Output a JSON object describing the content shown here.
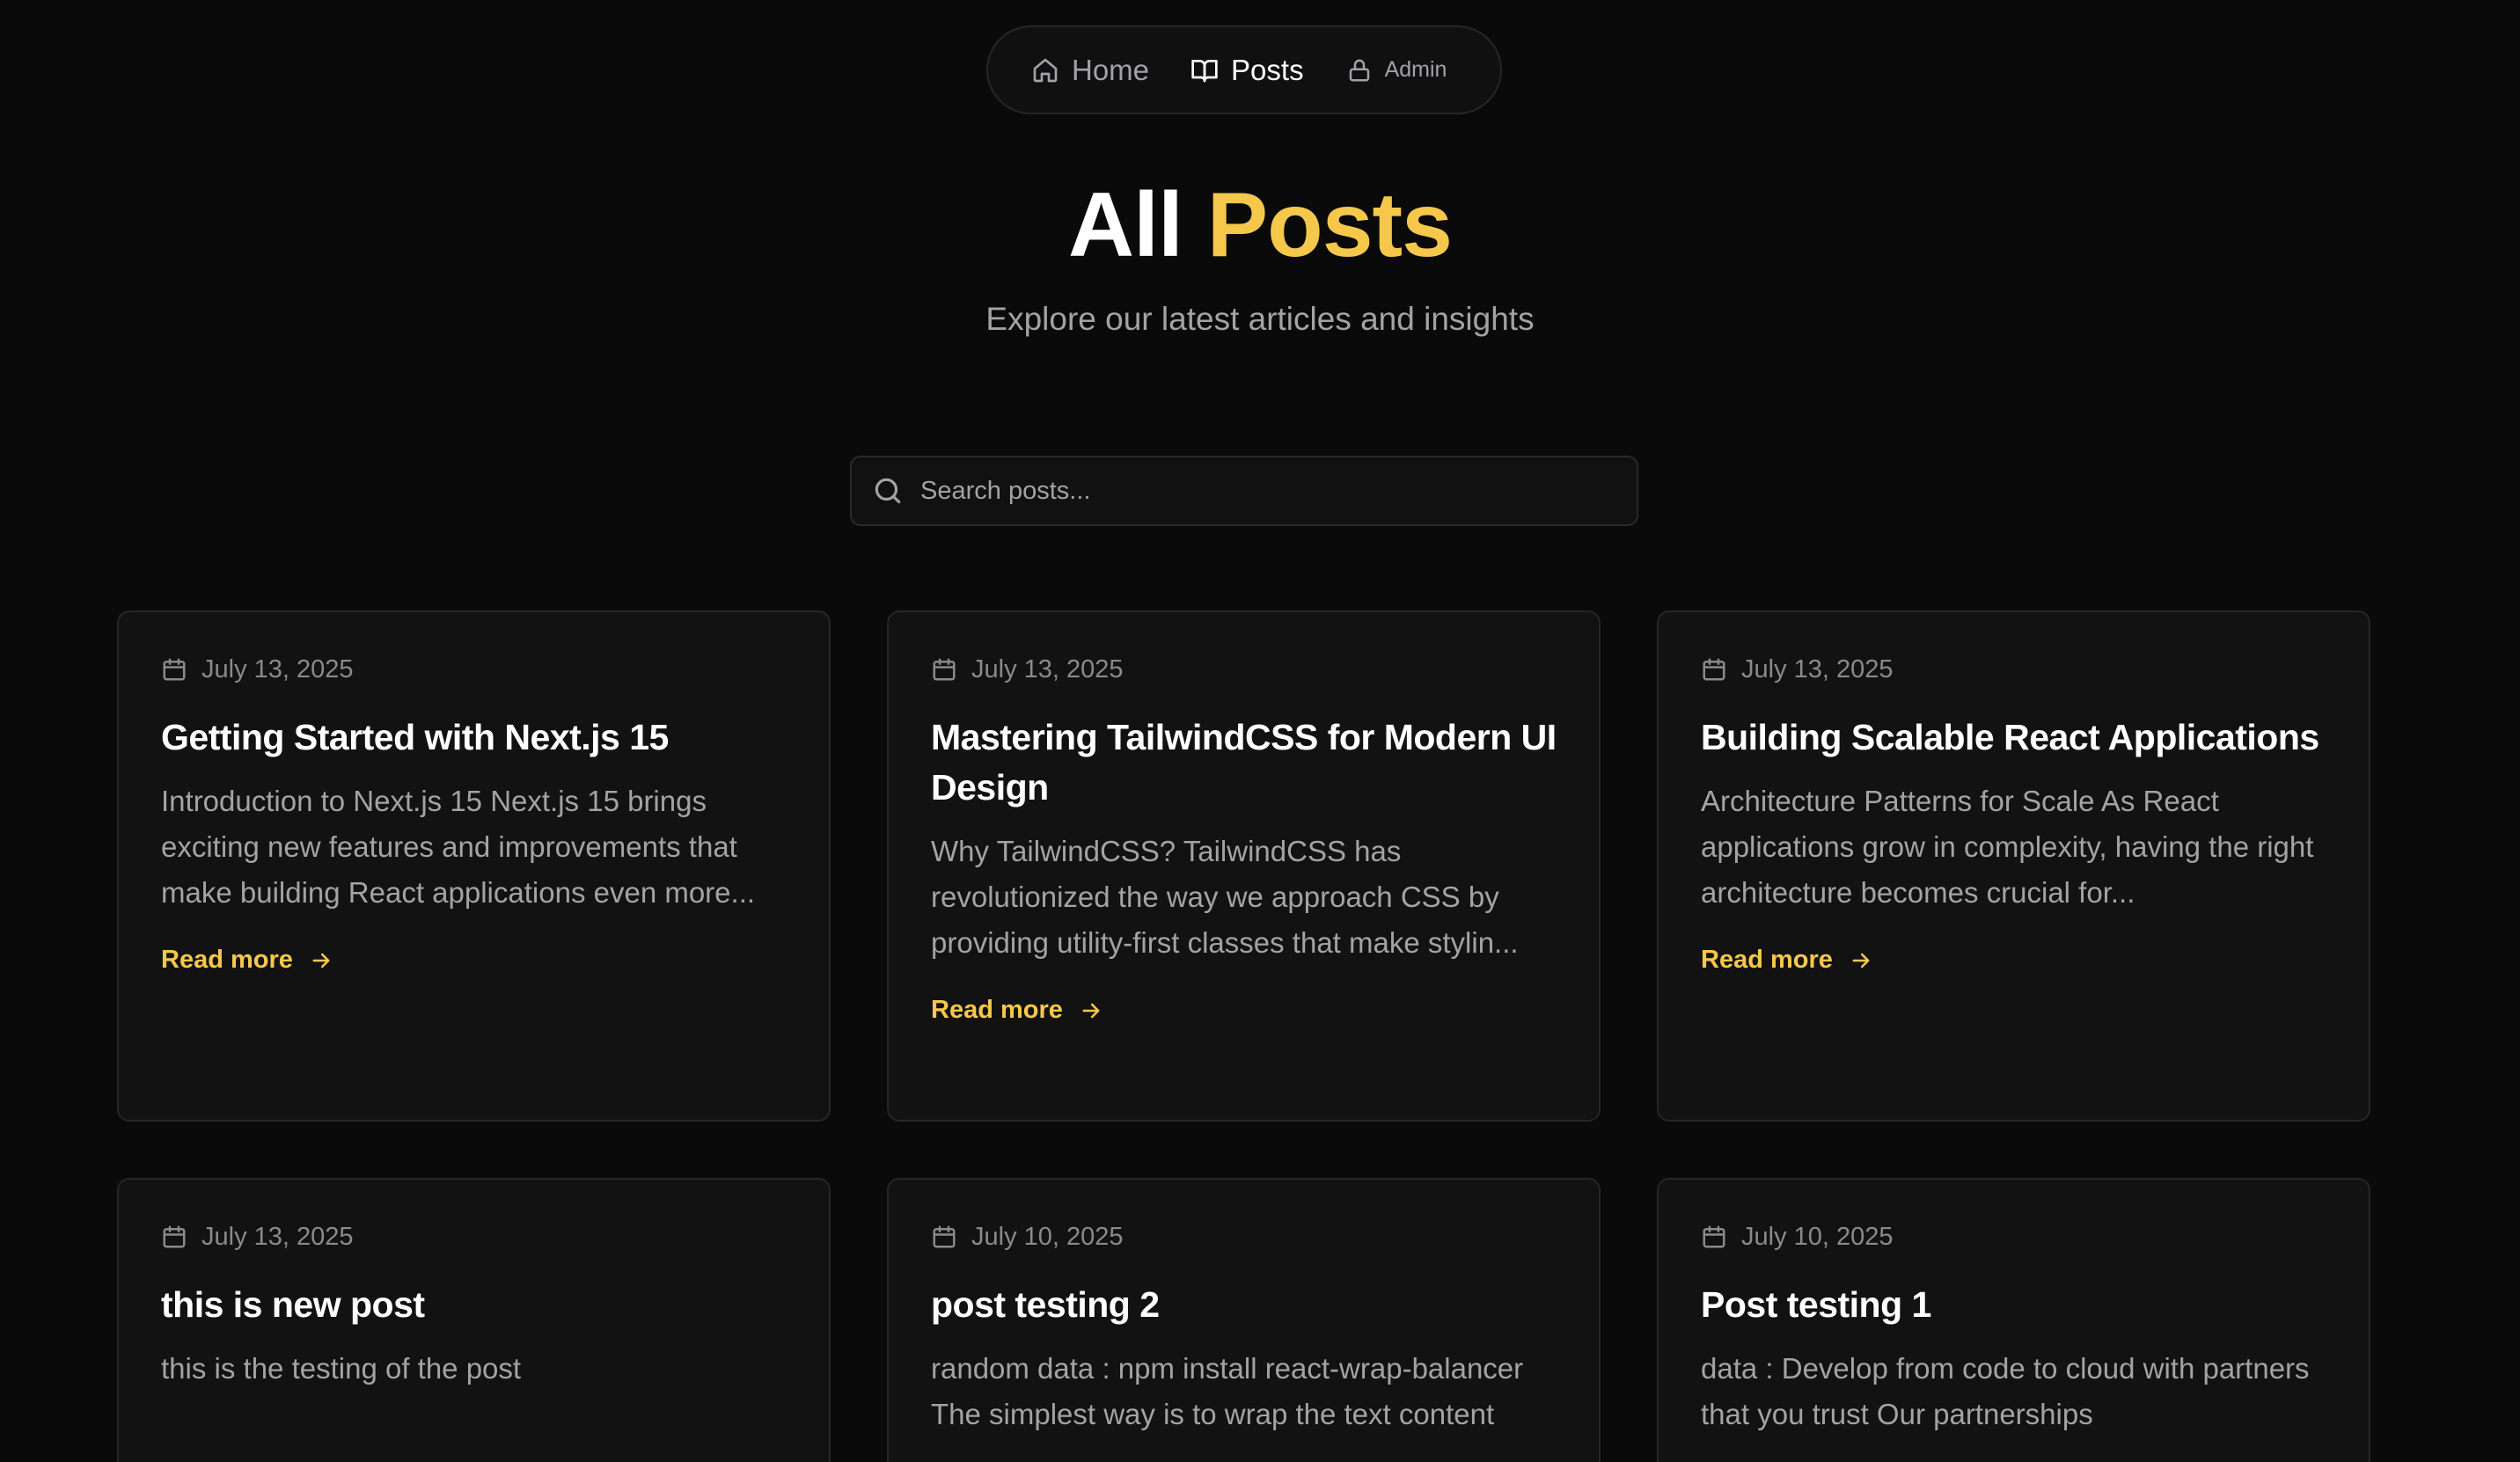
{
  "nav": {
    "home_label": "Home",
    "posts_label": "Posts",
    "admin_label": "Admin",
    "active": "Posts"
  },
  "hero": {
    "title_word1": "All",
    "title_word2": "Posts",
    "subtitle": "Explore our latest articles and insights"
  },
  "search": {
    "placeholder": "Search posts...",
    "value": ""
  },
  "colors": {
    "background": "#0a0a0a",
    "card": "#121212",
    "accent": "#f5c84c",
    "muted_text": "#a3a3a3"
  },
  "icons": {
    "home": "home-icon",
    "posts": "book-open-icon",
    "admin": "lock-icon",
    "search": "search-icon",
    "date": "calendar-icon",
    "read_more": "arrow-right-icon"
  },
  "read_more_label": "Read more",
  "posts": [
    {
      "date": "July 13, 2025",
      "title": "Getting Started with Next.js 15",
      "excerpt": "Introduction to Next.js 15 Next.js 15 brings exciting new features and improvements that make building React applications even more..."
    },
    {
      "date": "July 13, 2025",
      "title": "Mastering TailwindCSS for Modern UI Design",
      "excerpt": "Why TailwindCSS? TailwindCSS has revolutionized the way we approach CSS by providing utility-first classes that make stylin..."
    },
    {
      "date": "July 13, 2025",
      "title": "Building Scalable React Applications",
      "excerpt": "Architecture Patterns for Scale As React applications grow in complexity, having the right architecture becomes crucial for..."
    },
    {
      "date": "July 13, 2025",
      "title": "this is new post",
      "excerpt": "this is the testing of the post"
    },
    {
      "date": "July 10, 2025",
      "title": "post testing 2",
      "excerpt": "random data : npm install react-wrap-balancer The simplest way is to wrap the text content"
    },
    {
      "date": "July 10, 2025",
      "title": "Post testing 1",
      "excerpt": "data : Develop from code to cloud with partners that you trust Our partnerships"
    }
  ]
}
